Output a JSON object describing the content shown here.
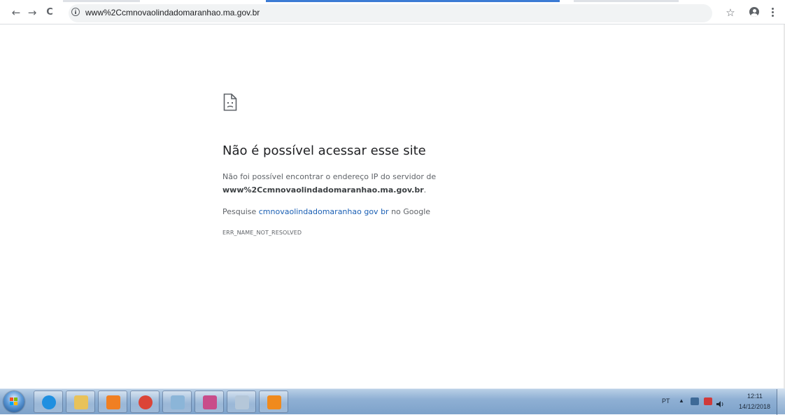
{
  "browser": {
    "url": "www%2Ccmnovaolindadomaranhao.ma.gov.br",
    "back_icon": "←",
    "forward_icon": "→",
    "reload_icon": "C",
    "star_icon": "☆"
  },
  "error_page": {
    "title": "Não é possível acessar esse site",
    "line1": "Não foi possível encontrar o endereço IP do servidor de",
    "host": "www%2Ccmnovaolindadomaranhao.ma.gov.br",
    "host_suffix": ".",
    "search_prefix": "Pesquise ",
    "search_link": "cmnovaolindadomaranhao gov br",
    "search_suffix": " no Google",
    "error_code": "ERR_NAME_NOT_RESOLVED"
  },
  "taskbar": {
    "pinned": [
      {
        "name": "internet-explorer-icon",
        "color": "#1f8fe0"
      },
      {
        "name": "file-explorer-icon",
        "color": "#e8c25a"
      },
      {
        "name": "media-player-icon",
        "color": "#f07f22"
      },
      {
        "name": "chrome-icon",
        "color": "#db4437"
      },
      {
        "name": "paint-icon",
        "color": "#8bb5d8"
      },
      {
        "name": "snipping-tool-icon",
        "color": "#c84c8a"
      },
      {
        "name": "calculator-icon",
        "color": "#b5c7d9"
      },
      {
        "name": "pdf-app-icon",
        "color": "#f08a1d"
      }
    ],
    "tray": {
      "language": "PT",
      "arrow": "▲",
      "time": "12:11",
      "date": "14/12/2018"
    }
  }
}
